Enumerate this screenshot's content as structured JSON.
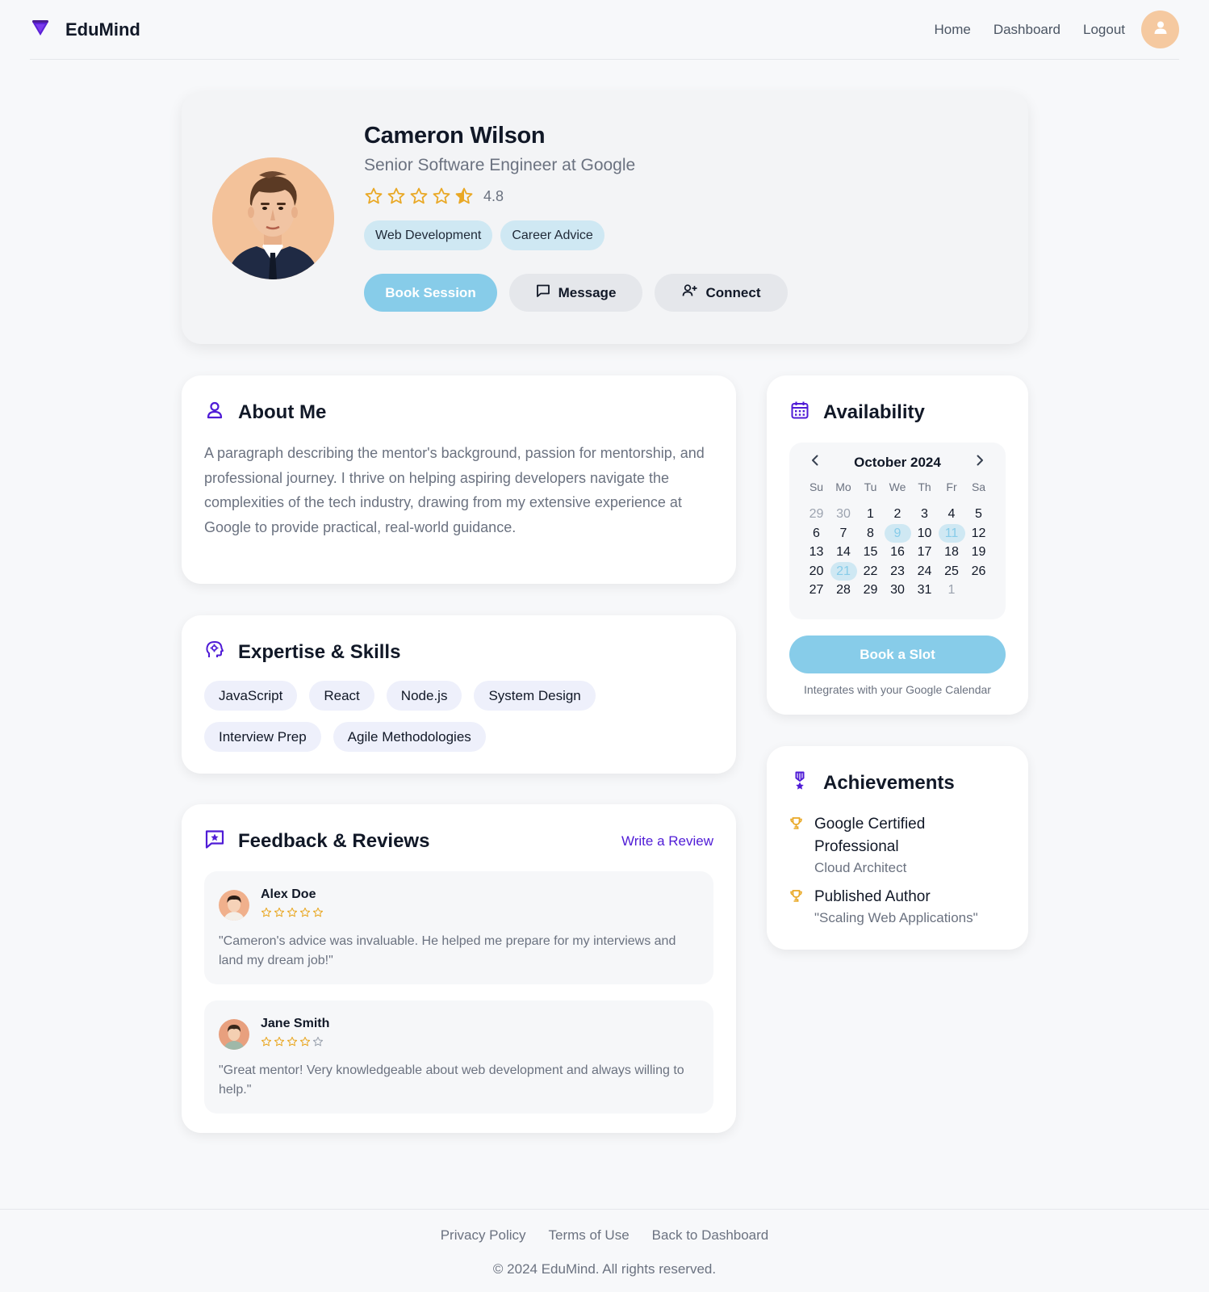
{
  "header": {
    "brand": "EduMind",
    "nav": [
      {
        "label": "Home"
      },
      {
        "label": "Dashboard"
      },
      {
        "label": "Logout"
      }
    ]
  },
  "profile": {
    "name": "Cameron Wilson",
    "title": "Senior Software Engineer at Google",
    "rating": 4.8,
    "rating_label": "4.8",
    "tags": [
      "Web Development",
      "Career Advice"
    ],
    "book_label": "Book Session",
    "message_label": "Message",
    "connect_label": "Connect"
  },
  "about": {
    "heading": "About Me",
    "text": "A paragraph describing the mentor's background, passion for mentorship, and professional journey. I thrive on helping aspiring developers navigate the complexities of the tech industry, drawing from my extensive experience at Google to provide practical, real-world guidance."
  },
  "skills": {
    "heading": "Expertise & Skills",
    "items": [
      "JavaScript",
      "React",
      "Node.js",
      "System Design",
      "Interview Prep",
      "Agile Methodologies"
    ]
  },
  "reviews": {
    "heading": "Feedback & Reviews",
    "write_label": "Write a Review",
    "items": [
      {
        "name": "Alex Doe",
        "stars": 5,
        "text": "\"Cameron's advice was invaluable. He helped me prepare for my interviews and land my dream job!\""
      },
      {
        "name": "Jane Smith",
        "stars": 4,
        "text": "\"Great mentor! Very knowledgeable about web development and always willing to help.\""
      }
    ]
  },
  "availability": {
    "heading": "Availability",
    "month": "October 2024",
    "weekdays": [
      "Su",
      "Mo",
      "Tu",
      "We",
      "Th",
      "Fr",
      "Sa"
    ],
    "days": [
      {
        "d": "29",
        "muted": true
      },
      {
        "d": "30",
        "muted": true
      },
      {
        "d": "1"
      },
      {
        "d": "2"
      },
      {
        "d": "3"
      },
      {
        "d": "4"
      },
      {
        "d": "5"
      },
      {
        "d": "6"
      },
      {
        "d": "7"
      },
      {
        "d": "8"
      },
      {
        "d": "9",
        "available": true
      },
      {
        "d": "10"
      },
      {
        "d": "11",
        "available": true
      },
      {
        "d": "12"
      },
      {
        "d": "13"
      },
      {
        "d": "14"
      },
      {
        "d": "15"
      },
      {
        "d": "16"
      },
      {
        "d": "17"
      },
      {
        "d": "18"
      },
      {
        "d": "19"
      },
      {
        "d": "20"
      },
      {
        "d": "21",
        "available": true
      },
      {
        "d": "22"
      },
      {
        "d": "23"
      },
      {
        "d": "24"
      },
      {
        "d": "25"
      },
      {
        "d": "26"
      },
      {
        "d": "27"
      },
      {
        "d": "28"
      },
      {
        "d": "29"
      },
      {
        "d": "30"
      },
      {
        "d": "31"
      },
      {
        "d": "1",
        "muted": true
      }
    ],
    "book_label": "Book a Slot",
    "note": "Integrates with your Google Calendar"
  },
  "achievements": {
    "heading": "Achievements",
    "items": [
      {
        "title": "Google Certified Professional",
        "subtitle": "Cloud Architect"
      },
      {
        "title": "Published Author",
        "subtitle": "\"Scaling Web Applications\""
      }
    ]
  },
  "footer": {
    "links": [
      "Privacy Policy",
      "Terms of Use",
      "Back to Dashboard"
    ],
    "copyright": "© 2024 EduMind. All rights reserved."
  },
  "colors": {
    "accent": "#4f1bd6",
    "primary_button": "#87cce9",
    "star": "#e9a825",
    "background": "#f7f8fa"
  }
}
